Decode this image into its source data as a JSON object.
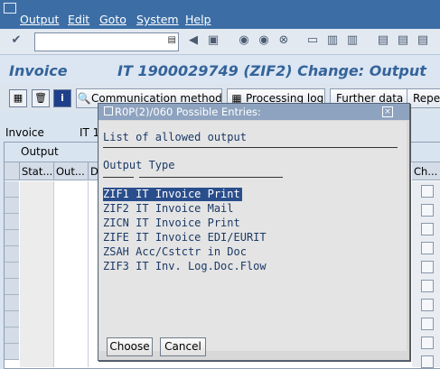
{
  "menu": [
    "Output",
    "Edit",
    "Goto",
    "System",
    "Help"
  ],
  "title": {
    "left": "Invoice",
    "right": "IT 1900029749 (ZIF2) Change: Output"
  },
  "app_toolbar": {
    "communication_method": "Communication method",
    "processing_log": "Processing log",
    "further_data": "Further data",
    "repeat": "Repea"
  },
  "content": {
    "invoice_label": "Invoice",
    "it_label": "IT 1",
    "output_label": "Output"
  },
  "grid": {
    "headers": [
      "Stat...",
      "Out...",
      "D",
      "Ch..."
    ]
  },
  "popup": {
    "title": "R0P(2)/060 Possible Entries:",
    "heading": "List of allowed output",
    "column_title": "Output Type",
    "options": [
      {
        "code": "ZIF1",
        "text": "IT Invoice Print",
        "selected": true
      },
      {
        "code": "ZIF2",
        "text": "IT Invoice Mail",
        "selected": false
      },
      {
        "code": "ZICN",
        "text": "IT Invoice Print",
        "selected": false
      },
      {
        "code": "ZIFE",
        "text": "IT Invoice EDI/EURIT",
        "selected": false
      },
      {
        "code": "ZSAH",
        "text": "Acc/Cstctr in Doc",
        "selected": false
      },
      {
        "code": "ZIF3",
        "text": "IT Inv. Log.Doc.Flow",
        "selected": false
      }
    ],
    "choose_label": "Choose",
    "cancel_label": "Cancel"
  },
  "colors": {
    "menubar": "#3c6ea5",
    "title_text": "#35639a",
    "selection": "#2a4e8c"
  }
}
